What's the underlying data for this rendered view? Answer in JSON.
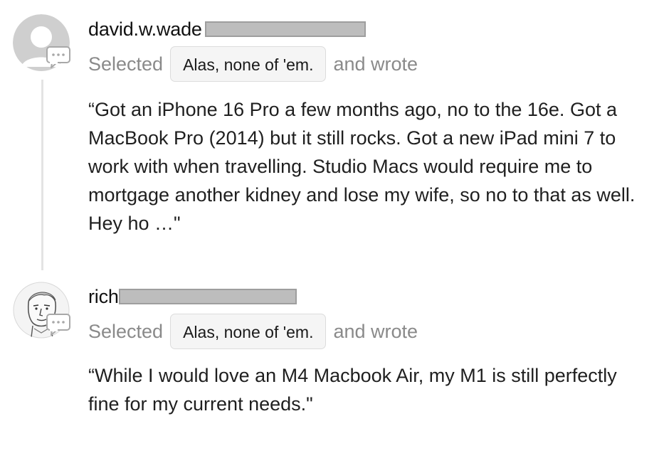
{
  "comments": [
    {
      "username": "david.w.wade",
      "selected_prefix": "Selected",
      "choice": "Alas, none of 'em.",
      "selected_suffix": "and wrote",
      "text": "“Got an iPhone 16 Pro a few months ago, no to the 16e. Got a MacBook Pro (2014) but it still rocks. Got a new iPad mini 7 to work with when travelling. Studio Macs would require me to mortgage another kidney and lose my wife, so no to that as well. Hey ho …\"",
      "avatar_icon": "default-avatar-icon",
      "badge_icon": "chat-bubble-icon"
    },
    {
      "username": "rich",
      "selected_prefix": "Selected",
      "choice": "Alas, none of 'em.",
      "selected_suffix": "and wrote",
      "text": "“While I would love an M4 Macbook Air, my M1 is still perfectly fine for my current needs.\"",
      "avatar_icon": "sketch-portrait-avatar-icon",
      "badge_icon": "chat-bubble-icon"
    }
  ],
  "colors": {
    "muted_text": "#8a8a8a",
    "chip_background": "#f5f5f5",
    "chip_border": "#dcdcdc",
    "badge_color": "#a8a8a8",
    "redaction": "#bdbdbd",
    "thread_line": "#e3e3e3"
  }
}
